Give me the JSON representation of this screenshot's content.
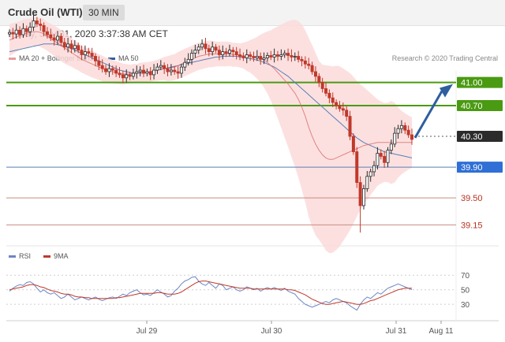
{
  "header": {
    "title": "Crude Oil (WTI)",
    "timeframe": "30 MIN"
  },
  "datetime": "Friday, July 31, 2020 3:37:38 AM CET",
  "legend": {
    "bollinger": "MA 20 + Bollinger Bands",
    "ma50": "MA 50",
    "credit": "Research © 2020 Trading Central"
  },
  "rsi_legend": {
    "rsi": "RSI",
    "ma": "9MA"
  },
  "colors": {
    "up": "#2b2b2b",
    "down": "#c0392b",
    "bands": "#fbdada",
    "ma20": "#d96b6b",
    "ma50": "#5a7fb5",
    "green": "#4a9a12",
    "blue_line": "#5a7fb5",
    "red_line": "#c98b7f",
    "arrow": "#2f5e9e",
    "rsi": "#6b86c4",
    "rsi_ma": "#c0392b"
  },
  "chart_data": [
    {
      "type": "candlestick",
      "ylim": [
        39.0,
        41.15
      ],
      "x_ticks": [
        "Jul 29",
        "Jul 30",
        "Jul 31",
        "Aug 11"
      ],
      "levels": [
        {
          "value": 41.0,
          "label": "41.00",
          "style": "resistance"
        },
        {
          "value": 40.7,
          "label": "40.70",
          "style": "resistance"
        },
        {
          "value": 40.3,
          "label": "40.30",
          "style": "last-price"
        },
        {
          "value": 39.9,
          "label": "39.90",
          "style": "pivot"
        },
        {
          "value": 39.5,
          "label": "39.50",
          "style": "support"
        },
        {
          "value": 39.15,
          "label": "39.15",
          "style": "support"
        }
      ],
      "close": [
        41.65,
        41.63,
        41.68,
        41.62,
        41.7,
        41.66,
        41.72,
        41.8,
        41.76,
        41.74,
        41.66,
        41.62,
        41.58,
        41.55,
        41.6,
        41.52,
        41.46,
        41.5,
        41.44,
        41.48,
        41.42,
        41.36,
        41.4,
        41.38,
        41.34,
        41.28,
        41.22,
        41.18,
        41.14,
        41.18,
        41.16,
        41.12,
        41.1,
        41.06,
        41.1,
        41.08,
        41.12,
        41.14,
        41.16,
        41.12,
        41.14,
        41.1,
        41.16,
        41.2,
        41.22,
        41.18,
        41.14,
        41.16,
        41.14,
        41.12,
        41.2,
        41.26,
        41.3,
        41.38,
        41.42,
        41.46,
        41.5,
        41.44,
        41.4,
        41.46,
        41.42,
        41.36,
        41.4,
        41.38,
        41.42,
        41.4,
        41.36,
        41.34,
        41.32,
        41.36,
        41.34,
        41.32,
        41.34,
        41.3,
        41.32,
        41.35,
        41.33,
        41.36,
        41.34,
        41.36,
        41.38,
        41.35,
        41.33,
        41.34,
        41.3,
        41.28,
        41.24,
        41.22,
        41.14,
        41.08,
        41.0,
        40.92,
        40.86,
        40.8,
        40.74,
        40.7,
        40.66,
        40.64,
        40.56,
        40.3,
        40.1,
        39.7,
        39.4,
        39.62,
        39.78,
        39.84,
        39.92,
        40.08,
        40.04,
        39.96,
        40.12,
        40.2,
        40.34,
        40.4,
        40.44,
        40.38,
        40.32,
        40.26
      ],
      "ma20": [
        41.55,
        41.57,
        41.59,
        41.61,
        41.63,
        41.64,
        41.65,
        41.66,
        41.66,
        41.65,
        41.63,
        41.6,
        41.57,
        41.54,
        41.51,
        41.48,
        41.45,
        41.42,
        41.39,
        41.36,
        41.33,
        41.3,
        41.28,
        41.26,
        41.24,
        41.22,
        41.2,
        41.18,
        41.16,
        41.15,
        41.14,
        41.13,
        41.12,
        41.11,
        41.11,
        41.11,
        41.12,
        41.12,
        41.13,
        41.13,
        41.13,
        41.14,
        41.15,
        41.16,
        41.17,
        41.18,
        41.18,
        41.19,
        41.2,
        41.22,
        41.24,
        41.26,
        41.28,
        41.3,
        41.32,
        41.34,
        41.35,
        41.36,
        41.37,
        41.37,
        41.37,
        41.37,
        41.37,
        41.37,
        41.37,
        41.36,
        41.36,
        41.35,
        41.35,
        41.34,
        41.34,
        41.33,
        41.32,
        41.31,
        41.29,
        41.26,
        41.22,
        41.18,
        41.13,
        41.08,
        41.03,
        40.98,
        40.92,
        40.86,
        40.78,
        40.68,
        40.56,
        40.42,
        40.3,
        40.2,
        40.12,
        40.06,
        40.02,
        40.0,
        40.0,
        40.02,
        40.04,
        40.06,
        40.08,
        40.1,
        40.12,
        40.14,
        40.16,
        40.18,
        40.19,
        40.2,
        40.21,
        40.22,
        40.22,
        40.22,
        40.22,
        40.22,
        40.22,
        40.22,
        40.22,
        40.22,
        40.22,
        40.22
      ],
      "ma50": [
        41.4,
        41.41,
        41.42,
        41.43,
        41.44,
        41.45,
        41.46,
        41.47,
        41.48,
        41.49,
        41.5,
        41.5,
        41.5,
        41.5,
        41.49,
        41.48,
        41.47,
        41.46,
        41.44,
        41.42,
        41.4,
        41.38,
        41.36,
        41.34,
        41.32,
        41.3,
        41.28,
        41.26,
        41.24,
        41.22,
        41.2,
        41.18,
        41.16,
        41.15,
        41.14,
        41.13,
        41.12,
        41.12,
        41.12,
        41.12,
        41.13,
        41.14,
        41.15,
        41.16,
        41.17,
        41.18,
        41.19,
        41.2,
        41.21,
        41.22,
        41.23,
        41.24,
        41.25,
        41.26,
        41.27,
        41.28,
        41.29,
        41.3,
        41.31,
        41.32,
        41.33,
        41.33,
        41.34,
        41.34,
        41.34,
        41.34,
        41.34,
        41.33,
        41.33,
        41.32,
        41.31,
        41.3,
        41.29,
        41.28,
        41.26,
        41.24,
        41.22,
        41.2,
        41.17,
        41.14,
        41.11,
        41.08,
        41.04,
        41.0,
        40.96,
        40.92,
        40.88,
        40.84,
        40.8,
        40.76,
        40.72,
        40.68,
        40.64,
        40.6,
        40.56,
        40.52,
        40.48,
        40.44,
        40.4,
        40.36,
        40.32,
        40.28,
        40.25,
        40.22,
        40.2,
        40.18,
        40.16,
        40.14,
        40.12,
        40.1,
        40.09,
        40.08,
        40.07,
        40.06,
        40.05,
        40.04,
        40.03,
        40.02
      ]
    },
    {
      "type": "line",
      "title": "RSI",
      "ylim": [
        15,
        80
      ],
      "y_ticks": [
        70,
        50,
        30
      ],
      "series": [
        {
          "name": "RSI",
          "values": [
            48,
            52,
            55,
            57,
            56,
            60,
            61,
            58,
            52,
            47,
            50,
            46,
            44,
            46,
            42,
            38,
            40,
            44,
            40,
            36,
            38,
            40,
            38,
            36,
            38,
            40,
            37,
            35,
            37,
            39,
            40,
            38,
            41,
            44,
            42,
            46,
            48,
            50,
            46,
            43,
            44,
            42,
            46,
            50,
            47,
            44,
            40,
            42,
            48,
            52,
            58,
            62,
            64,
            67,
            68,
            62,
            58,
            56,
            60,
            56,
            52,
            58,
            56,
            50,
            52,
            54,
            50,
            48,
            50,
            54,
            52,
            50,
            52,
            48,
            51,
            53,
            51,
            53,
            51,
            49,
            52,
            48,
            46,
            44,
            38,
            34,
            30,
            28,
            26,
            28,
            30,
            32,
            34,
            32,
            36,
            38,
            36,
            34,
            32,
            28,
            25,
            22,
            30,
            36,
            40,
            38,
            42,
            46,
            44,
            48,
            52,
            54,
            56,
            58,
            56,
            54,
            52,
            50
          ]
        },
        {
          "name": "9MA",
          "values": [
            50,
            51,
            52,
            53,
            54,
            56,
            57,
            57,
            56,
            54,
            53,
            51,
            49,
            48,
            47,
            45,
            44,
            44,
            43,
            41,
            40,
            40,
            39,
            39,
            38,
            38,
            38,
            38,
            38,
            38,
            38,
            39,
            39,
            40,
            41,
            42,
            43,
            44,
            45,
            45,
            45,
            45,
            45,
            46,
            46,
            45,
            44,
            44,
            44,
            45,
            47,
            50,
            53,
            56,
            59,
            61,
            62,
            62,
            61,
            60,
            59,
            58,
            57,
            56,
            55,
            54,
            53,
            52,
            52,
            52,
            52,
            51,
            51,
            51,
            51,
            51,
            51,
            51,
            51,
            51,
            51,
            50,
            50,
            49,
            47,
            45,
            43,
            40,
            37,
            35,
            33,
            31,
            30,
            30,
            31,
            32,
            33,
            34,
            33,
            32,
            31,
            30,
            30,
            31,
            33,
            35,
            36,
            38,
            40,
            42,
            44,
            46,
            48,
            50,
            51,
            52,
            52,
            52
          ]
        }
      ]
    }
  ]
}
